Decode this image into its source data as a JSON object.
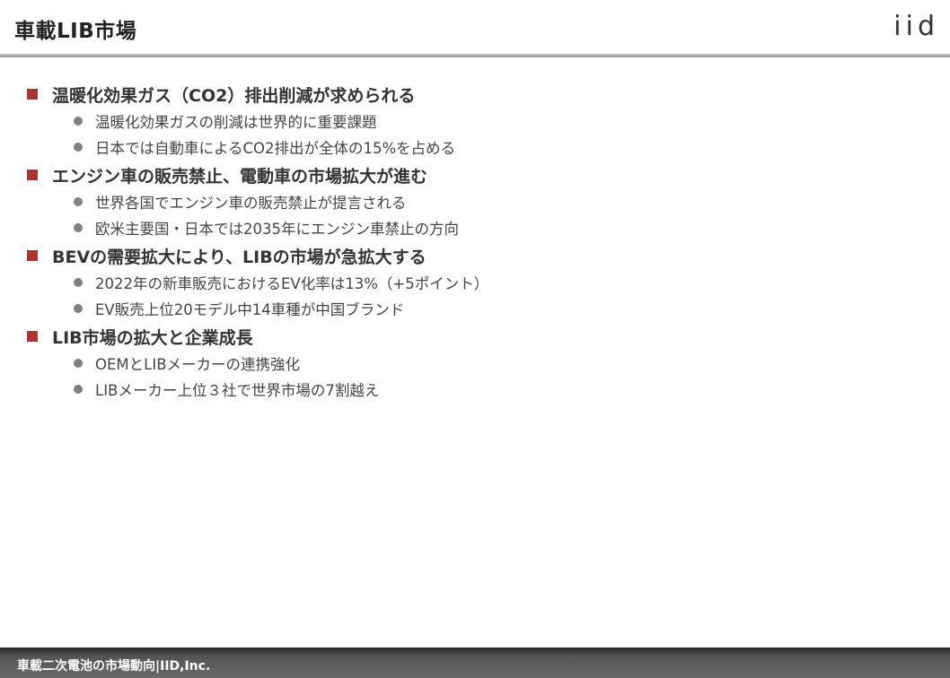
{
  "header": {
    "title": "車載LIB市場",
    "logo_text": "iid"
  },
  "sections": [
    {
      "heading": "温暖化効果ガス（CO2）排出削減が求められる",
      "items": [
        "温暖化効果ガスの削減は世界的に重要課題",
        "日本では自動車によるCO2排出が全体の15%を占める"
      ]
    },
    {
      "heading": "エンジン車の販売禁止、電動車の市場拡大が進む",
      "items": [
        "世界各国でエンジン車の販売禁止が提言される",
        "欧米主要国・日本では2035年にエンジン車禁止の方向"
      ]
    },
    {
      "heading": "BEVの需要拡大により、LIBの市場が急拡大する",
      "items": [
        "2022年の新車販売におけるEV化率は13%（+5ポイント）",
        "EV販売上位20モデル中14車種が中国ブランド"
      ]
    },
    {
      "heading": "LIB市場の拡大と企業成長",
      "items": [
        "OEMとLIBメーカーの連携強化",
        "LIBメーカー上位３社で世界市場の7割越え"
      ]
    }
  ],
  "footer": {
    "text": "車載二次電池の市場動向|IID,Inc."
  },
  "colors": {
    "accent": "#a63533",
    "bullet_gray": "#808080",
    "footer_bg": "#555555"
  }
}
